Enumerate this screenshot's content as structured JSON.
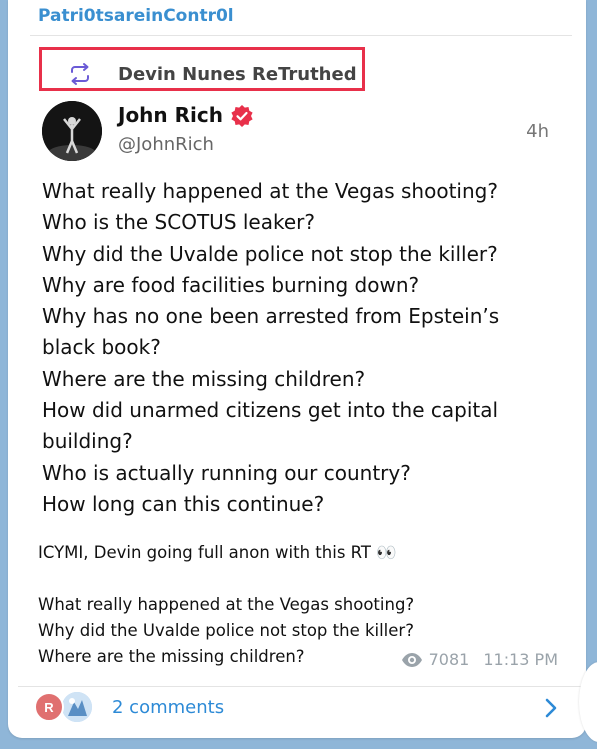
{
  "channel": {
    "name": "Patri0tsareinContr0l"
  },
  "repost": {
    "label": "Devin Nunes ReTruthed",
    "highlight_color": "#e8304a"
  },
  "post": {
    "author": "John Rich",
    "handle": "@JohnRich",
    "age": "4h",
    "verified_icon": "verified-badge-icon",
    "lines": [
      "What really happened at the Vegas shooting?",
      "Who is the SCOTUS leaker?",
      "Why did the Uvalde police not stop the killer?",
      "Why are food facilities burning down?",
      "Why has no one been arrested from Epstein’s",
      "black book?",
      "Where are the missing children?",
      "How did unarmed citizens get into the capital",
      "building?",
      "Who is actually running our country?",
      "How long can this continue?"
    ]
  },
  "caption": {
    "lines": [
      "ICYMI, Devin going full anon with this RT 👀",
      "",
      "What really happened at the Vegas shooting?",
      "Why did the Uvalde police not stop the killer?",
      "Where are the missing children?"
    ]
  },
  "meta": {
    "views": "7081",
    "time": "11:13 PM"
  },
  "footer": {
    "avatar_initial": "R",
    "comments_label": "2 comments"
  },
  "colors": {
    "link": "#2d8ad6",
    "background": "#8fb6d8",
    "verified": "#e8304a"
  }
}
